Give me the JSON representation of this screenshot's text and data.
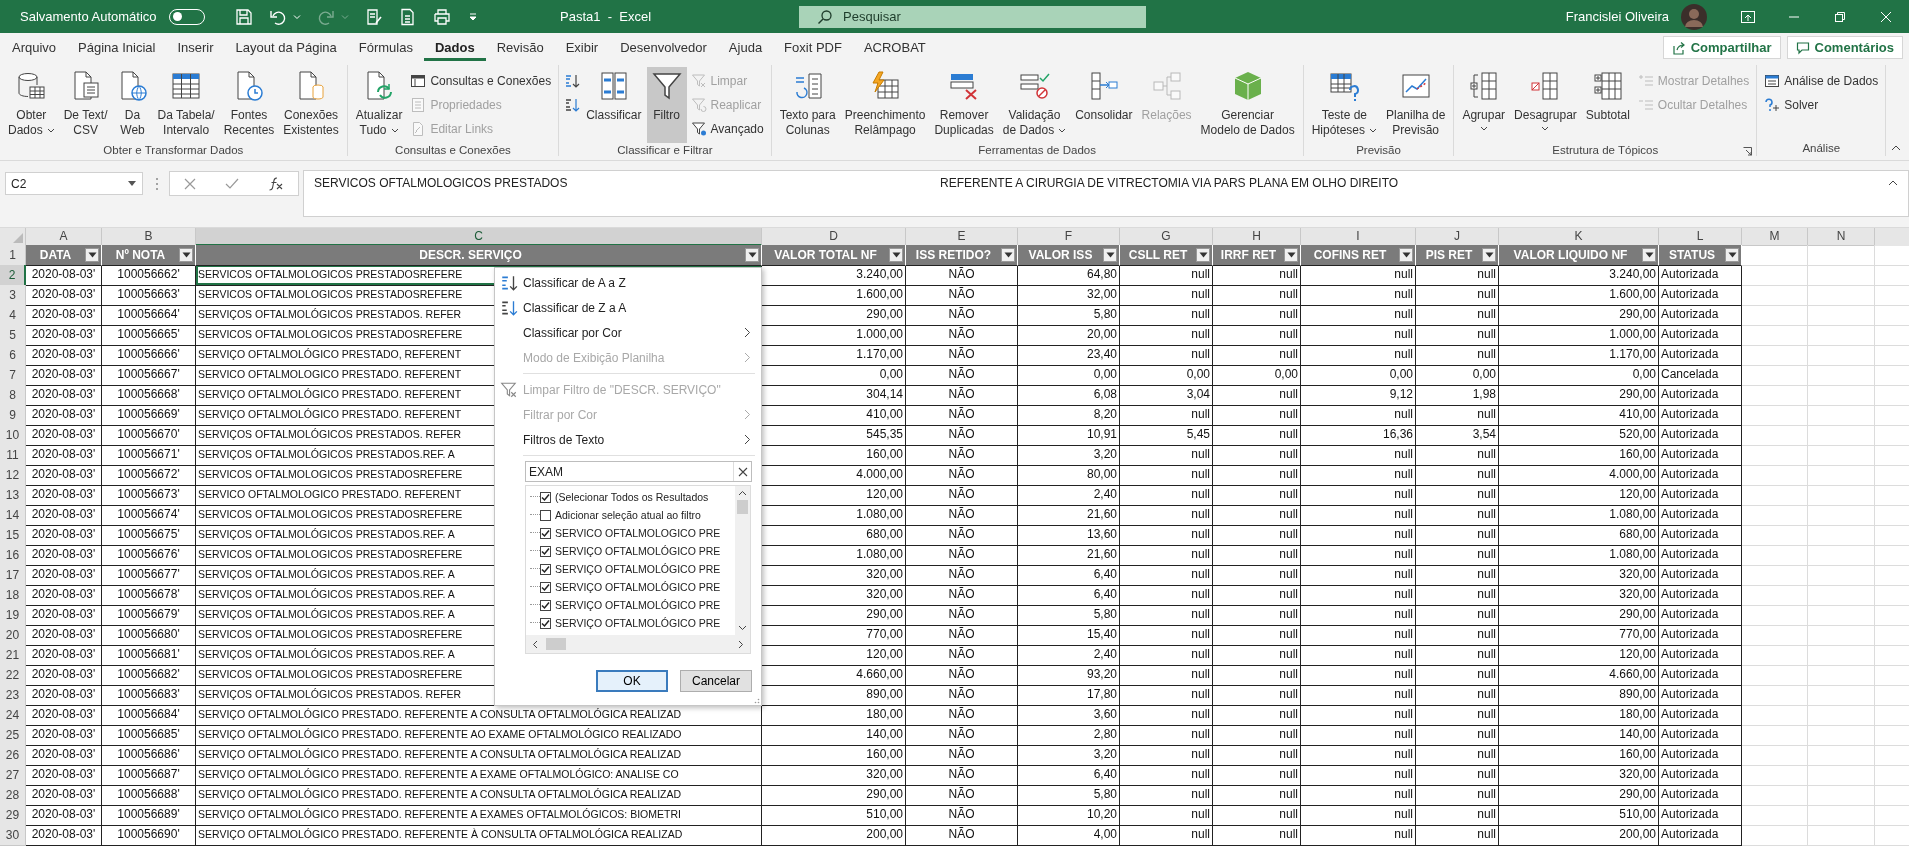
{
  "title_bar": {
    "autosave_label": "Salvamento Automático",
    "autosave_on": false,
    "title": "Pasta1  -  Excel",
    "search_placeholder": "Pesquisar",
    "user": "Francislei Oliveira"
  },
  "menu_tabs": [
    {
      "label": "Arquivo",
      "selected": false
    },
    {
      "label": "Página Inicial",
      "selected": false
    },
    {
      "label": "Inserir",
      "selected": false
    },
    {
      "label": "Layout da Página",
      "selected": false
    },
    {
      "label": "Fórmulas",
      "selected": false
    },
    {
      "label": "Dados",
      "selected": true
    },
    {
      "label": "Revisão",
      "selected": false
    },
    {
      "label": "Exibir",
      "selected": false
    },
    {
      "label": "Desenvolvedor",
      "selected": false
    },
    {
      "label": "Ajuda",
      "selected": false
    },
    {
      "label": "Foxit PDF",
      "selected": false
    },
    {
      "label": "ACROBAT",
      "selected": false
    }
  ],
  "share_button": "Compartilhar",
  "comments_button": "Comentários",
  "ribbon_groups": [
    {
      "title": "Obter e Transformar Dados",
      "launcher": false,
      "items": [
        {
          "kind": "large",
          "lines": [
            "Obter",
            "Dados"
          ],
          "dropdown": true,
          "disabled": false,
          "on": false
        },
        {
          "kind": "large",
          "lines": [
            "De Text/",
            "CSV"
          ],
          "dropdown": false,
          "disabled": false,
          "on": false
        },
        {
          "kind": "large",
          "lines": [
            "Da",
            "Web"
          ],
          "dropdown": false,
          "disabled": false,
          "on": false
        },
        {
          "kind": "large",
          "lines": [
            "Da Tabela/",
            "Intervalo"
          ],
          "dropdown": false,
          "disabled": false,
          "on": false
        },
        {
          "kind": "large",
          "lines": [
            "Fontes",
            "Recentes"
          ],
          "dropdown": false,
          "disabled": false,
          "on": false
        },
        {
          "kind": "large",
          "lines": [
            "Conexões",
            "Existentes"
          ],
          "dropdown": false,
          "disabled": false,
          "on": false
        }
      ]
    },
    {
      "title": "Consultas e Conexões",
      "launcher": false,
      "items": [
        {
          "kind": "large",
          "lines": [
            "Atualizar",
            "Tudo"
          ],
          "dropdown": true,
          "disabled": false,
          "on": false
        },
        {
          "kind": "stack",
          "items": [
            {
              "kind": "small",
              "label": "Consultas e Conexões",
              "dropdown": false,
              "disabled": false,
              "on": false
            },
            {
              "kind": "small",
              "label": "Propriedades",
              "dropdown": false,
              "disabled": true,
              "on": false
            },
            {
              "kind": "small",
              "label": "Editar Links",
              "dropdown": false,
              "disabled": true,
              "on": false
            }
          ]
        }
      ]
    },
    {
      "title": "Classificar e Filtrar",
      "launcher": false,
      "items": [
        {
          "kind": "stack",
          "items": [
            {
              "kind": "icon",
              "dropdown": false,
              "disabled": false,
              "on": false
            },
            {
              "kind": "icon",
              "dropdown": false,
              "disabled": false,
              "on": false
            }
          ]
        },
        {
          "kind": "large",
          "lines": [
            "Classificar"
          ],
          "dropdown": false,
          "disabled": false,
          "on": false
        },
        {
          "kind": "large",
          "lines": [
            "Filtro"
          ],
          "dropdown": false,
          "disabled": false,
          "on": true
        },
        {
          "kind": "stack",
          "items": [
            {
              "kind": "small",
              "label": "Limpar",
              "dropdown": false,
              "disabled": true,
              "on": false
            },
            {
              "kind": "small",
              "label": "Reaplicar",
              "dropdown": false,
              "disabled": true,
              "on": false
            },
            {
              "kind": "small",
              "label": "Avançado",
              "dropdown": false,
              "disabled": false,
              "on": false
            }
          ]
        }
      ]
    },
    {
      "title": "Ferramentas de Dados",
      "launcher": false,
      "items": [
        {
          "kind": "large",
          "lines": [
            "Texto para",
            "Colunas"
          ],
          "dropdown": false,
          "disabled": false,
          "on": false
        },
        {
          "kind": "large",
          "lines": [
            "Preenchimento",
            "Relâmpago"
          ],
          "dropdown": false,
          "disabled": false,
          "on": false
        },
        {
          "kind": "large",
          "lines": [
            "Remover",
            "Duplicadas"
          ],
          "dropdown": false,
          "disabled": false,
          "on": false
        },
        {
          "kind": "large",
          "lines": [
            "Validação",
            "de Dados"
          ],
          "dropdown": true,
          "disabled": false,
          "on": false
        },
        {
          "kind": "large",
          "lines": [
            "Consolidar"
          ],
          "dropdown": false,
          "disabled": false,
          "on": false
        },
        {
          "kind": "large",
          "lines": [
            "Relações"
          ],
          "dropdown": false,
          "disabled": true,
          "on": false
        },
        {
          "kind": "large",
          "lines": [
            "Gerenciar",
            "Modelo de Dados"
          ],
          "dropdown": false,
          "disabled": false,
          "on": false
        }
      ]
    },
    {
      "title": "Previsão",
      "launcher": false,
      "items": [
        {
          "kind": "large",
          "lines": [
            "Teste de",
            "Hipóteses"
          ],
          "dropdown": true,
          "disabled": false,
          "on": false
        },
        {
          "kind": "large",
          "lines": [
            "Planilha de",
            "Previsão"
          ],
          "dropdown": false,
          "disabled": false,
          "on": false
        }
      ]
    },
    {
      "title": "Estrutura de Tópicos",
      "launcher": true,
      "items": [
        {
          "kind": "large",
          "lines": [
            "Agrupar"
          ],
          "dropdown": true,
          "disabled": false,
          "on": false
        },
        {
          "kind": "large",
          "lines": [
            "Desagrupar"
          ],
          "dropdown": true,
          "disabled": false,
          "on": false
        },
        {
          "kind": "large",
          "lines": [
            "Subtotal"
          ],
          "dropdown": false,
          "disabled": false,
          "on": false
        },
        {
          "kind": "stack",
          "items": [
            {
              "kind": "small",
              "label": "Mostrar Detalhes",
              "dropdown": false,
              "disabled": true,
              "on": false
            },
            {
              "kind": "small",
              "label": "Ocultar Detalhes",
              "dropdown": false,
              "disabled": true,
              "on": false
            }
          ]
        }
      ]
    },
    {
      "title": "Análise",
      "launcher": false,
      "items": [
        {
          "kind": "stack",
          "items": [
            {
              "kind": "small",
              "label": "Análise de Dados",
              "dropdown": false,
              "disabled": false,
              "on": false
            },
            {
              "kind": "small",
              "label": "Solver",
              "dropdown": false,
              "disabled": false,
              "on": false
            }
          ]
        }
      ]
    }
  ],
  "formula_bar": {
    "name_box": "C2",
    "value_parts": [
      "SERVICOS OFTALMOLOGICOS PRESTADOS",
      "REFERENTE A CIRURGIA DE VITRECTOMIA VIA PARS PLANA EM OLHO DIREITO"
    ]
  },
  "sheet": {
    "columns": [
      {
        "letter": "A",
        "selected": false
      },
      {
        "letter": "B",
        "selected": false
      },
      {
        "letter": "C",
        "selected": true
      },
      {
        "letter": "D",
        "selected": false
      },
      {
        "letter": "E",
        "selected": false
      },
      {
        "letter": "F",
        "selected": false
      },
      {
        "letter": "G",
        "selected": false
      },
      {
        "letter": "H",
        "selected": false
      },
      {
        "letter": "I",
        "selected": false
      },
      {
        "letter": "J",
        "selected": false
      },
      {
        "letter": "K",
        "selected": false
      },
      {
        "letter": "L",
        "selected": false
      },
      {
        "letter": "M",
        "selected": false
      },
      {
        "letter": "N",
        "selected": false
      }
    ],
    "header_row": {
      "number": "1",
      "cells": [
        "DATA",
        "Nº NOTA",
        "DESCR. SERVIÇO",
        "VALOR TOTAL NF",
        "ISS RETIDO?",
        "VALOR ISS",
        "CSLL RET",
        "IRRF RET",
        "COFINS RET",
        "PIS RET",
        "VALOR LIQUIDO NF",
        "STATUS"
      ]
    },
    "rows": [
      {
        "number": "2",
        "selected": true,
        "cells": [
          "2020-08-03'",
          "100056662'",
          "SERVICOS OFTALMOLOGICOS PRESTADOSREFERE",
          "3.240,00",
          "NÃO",
          "64,80",
          "null",
          "null",
          "null",
          "null",
          "3.240,00",
          "Autorizada"
        ]
      },
      {
        "number": "3",
        "selected": false,
        "cells": [
          "2020-08-03'",
          "100056663'",
          "SERVICOS OFTALMOLOGICOS PRESTADOSREFERE",
          "1.600,00",
          "NÃO",
          "32,00",
          "null",
          "null",
          "null",
          "null",
          "1.600,00",
          "Autorizada"
        ]
      },
      {
        "number": "4",
        "selected": false,
        "cells": [
          "2020-08-03'",
          "100056664'",
          "SERVIÇOS OFTALMOLÓGICOS PRESTADOS. REFER",
          "290,00",
          "NÃO",
          "5,80",
          "null",
          "null",
          "null",
          "null",
          "290,00",
          "Autorizada"
        ]
      },
      {
        "number": "5",
        "selected": false,
        "cells": [
          "2020-08-03'",
          "100056665'",
          "SERVICOS OFTALMOLOGICOS PRESTADOSREFERE",
          "1.000,00",
          "NÃO",
          "20,00",
          "null",
          "null",
          "null",
          "null",
          "1.000,00",
          "Autorizada"
        ]
      },
      {
        "number": "6",
        "selected": false,
        "cells": [
          "2020-08-03'",
          "100056666'",
          "SERVIÇO OFTALMOLÓGICO PRESTADO, REFERENT",
          "1.170,00",
          "NÃO",
          "23,40",
          "null",
          "null",
          "null",
          "null",
          "1.170,00",
          "Autorizada"
        ]
      },
      {
        "number": "7",
        "selected": false,
        "cells": [
          "2020-08-03'",
          "100056667'",
          "SERVICO OFTALMOLOGICO PRESTADO. REFERENT",
          "0,00",
          "NÃO",
          "0,00",
          "0,00",
          "0,00",
          "0,00",
          "0,00",
          "0,00",
          "Cancelada"
        ]
      },
      {
        "number": "8",
        "selected": false,
        "cells": [
          "2020-08-03'",
          "100056668'",
          "SERVIÇO OFTALMOLÓGICO PRESTADO. REFERENT",
          "304,14",
          "NÃO",
          "6,08",
          "3,04",
          "null",
          "9,12",
          "1,98",
          "290,00",
          "Autorizada"
        ]
      },
      {
        "number": "9",
        "selected": false,
        "cells": [
          "2020-08-03'",
          "100056669'",
          "SERVIÇO OFTALMOLÓGICO PRESTADO. REFERENT",
          "410,00",
          "NÃO",
          "8,20",
          "null",
          "null",
          "null",
          "null",
          "410,00",
          "Autorizada"
        ]
      },
      {
        "number": "10",
        "selected": false,
        "cells": [
          "2020-08-03'",
          "100056670'",
          "SERVIÇOS OFTALMOLÓGICOS PRESTADOS. REFER",
          "545,35",
          "NÃO",
          "10,91",
          "5,45",
          "null",
          "16,36",
          "3,54",
          "520,00",
          "Autorizada"
        ]
      },
      {
        "number": "11",
        "selected": false,
        "cells": [
          "2020-08-03'",
          "100056671'",
          "SERVIÇOS OFTALMOLÓGICOS PRESTADOS.REF. A",
          "160,00",
          "NÃO",
          "3,20",
          "null",
          "null",
          "null",
          "null",
          "160,00",
          "Autorizada"
        ]
      },
      {
        "number": "12",
        "selected": false,
        "cells": [
          "2020-08-03'",
          "100056672'",
          "SERVICOS OFTALMOLOGICOS PRESTADOSREFERE",
          "4.000,00",
          "NÃO",
          "80,00",
          "null",
          "null",
          "null",
          "null",
          "4.000,00",
          "Autorizada"
        ]
      },
      {
        "number": "13",
        "selected": false,
        "cells": [
          "2020-08-03'",
          "100056673'",
          "SERVICO OFTALMOLOGICO PRESTADO. REFERENT",
          "120,00",
          "NÃO",
          "2,40",
          "null",
          "null",
          "null",
          "null",
          "120,00",
          "Autorizada"
        ]
      },
      {
        "number": "14",
        "selected": false,
        "cells": [
          "2020-08-03'",
          "100056674'",
          "SERVICOS OFTALMOLOGICOS PRESTADOSREFERE",
          "1.080,00",
          "NÃO",
          "21,60",
          "null",
          "null",
          "null",
          "null",
          "1.080,00",
          "Autorizada"
        ]
      },
      {
        "number": "15",
        "selected": false,
        "cells": [
          "2020-08-03'",
          "100056675'",
          "SERVIÇOS OFTALMOLÓGICOS PRESTADOS.REF. A",
          "680,00",
          "NÃO",
          "13,60",
          "null",
          "null",
          "null",
          "null",
          "680,00",
          "Autorizada"
        ]
      },
      {
        "number": "16",
        "selected": false,
        "cells": [
          "2020-08-03'",
          "100056676'",
          "SERVICOS OFTALMOLOGICOS PRESTADOSREFERE",
          "1.080,00",
          "NÃO",
          "21,60",
          "null",
          "null",
          "null",
          "null",
          "1.080,00",
          "Autorizada"
        ]
      },
      {
        "number": "17",
        "selected": false,
        "cells": [
          "2020-08-03'",
          "100056677'",
          "SERVIÇOS OFTALMOLÓGICOS PRESTADOS.REF. A",
          "320,00",
          "NÃO",
          "6,40",
          "null",
          "null",
          "null",
          "null",
          "320,00",
          "Autorizada"
        ]
      },
      {
        "number": "18",
        "selected": false,
        "cells": [
          "2020-08-03'",
          "100056678'",
          "SERVIÇOS OFTALMOLÓGICOS PRESTADOS.REF. A",
          "320,00",
          "NÃO",
          "6,40",
          "null",
          "null",
          "null",
          "null",
          "320,00",
          "Autorizada"
        ]
      },
      {
        "number": "19",
        "selected": false,
        "cells": [
          "2020-08-03'",
          "100056679'",
          "SERVIÇOS OFTALMOLÓGICOS PRESTADOS.REF. A",
          "290,00",
          "NÃO",
          "5,80",
          "null",
          "null",
          "null",
          "null",
          "290,00",
          "Autorizada"
        ]
      },
      {
        "number": "20",
        "selected": false,
        "cells": [
          "2020-08-03'",
          "100056680'",
          "SERVICOS OFTALMOLOGICOS PRESTADOSREFERE",
          "770,00",
          "NÃO",
          "15,40",
          "null",
          "null",
          "null",
          "null",
          "770,00",
          "Autorizada"
        ]
      },
      {
        "number": "21",
        "selected": false,
        "cells": [
          "2020-08-03'",
          "100056681'",
          "SERVIÇOS OFTALMOLÓGICOS PRESTADOS.REF. A",
          "120,00",
          "NÃO",
          "2,40",
          "null",
          "null",
          "null",
          "null",
          "120,00",
          "Autorizada"
        ]
      },
      {
        "number": "22",
        "selected": false,
        "cells": [
          "2020-08-03'",
          "100056682'",
          "SERVICOS OFTALMOLOGICOS PRESTADOSREFERE",
          "4.660,00",
          "NÃO",
          "93,20",
          "null",
          "null",
          "null",
          "null",
          "4.660,00",
          "Autorizada"
        ]
      },
      {
        "number": "23",
        "selected": false,
        "cells": [
          "2020-08-03'",
          "100056683'",
          "SERVIÇOS OFTALMOLÓGICOS PRESTADOS. REFER",
          "890,00",
          "NÃO",
          "17,80",
          "null",
          "null",
          "null",
          "null",
          "890,00",
          "Autorizada"
        ]
      },
      {
        "number": "24",
        "selected": false,
        "cells": [
          "2020-08-03'",
          "100056684'",
          "SERVIÇO OFTALMOLÓGICO PRESTADO. REFERENTE A CONSULTA OFTALMOLÓGICA REALIZAD",
          "180,00",
          "NÃO",
          "3,60",
          "null",
          "null",
          "null",
          "null",
          "180,00",
          "Autorizada"
        ]
      },
      {
        "number": "25",
        "selected": false,
        "cells": [
          "2020-08-03'",
          "100056685'",
          "SERVIÇO OFTALMOLÓGICO PRESTADO. REFERENTE AO EXAME OFTALMOLÓGICO REALIZADO",
          "140,00",
          "NÃO",
          "2,80",
          "null",
          "null",
          "null",
          "null",
          "140,00",
          "Autorizada"
        ]
      },
      {
        "number": "26",
        "selected": false,
        "cells": [
          "2020-08-03'",
          "100056686'",
          "SERVIÇO OFTALMOLÓGICO PRESTADO. REFERENTE A CONSULTA OFTALMOLÓGICA REALIZAD",
          "160,00",
          "NÃO",
          "3,20",
          "null",
          "null",
          "null",
          "null",
          "160,00",
          "Autorizada"
        ]
      },
      {
        "number": "27",
        "selected": false,
        "cells": [
          "2020-08-03'",
          "100056687'",
          "SERVIÇO OFTALMOLÓGICO PRESTADO. REFERENTE A EXAME OFTALMOLÓGICO: ANALISE CO",
          "320,00",
          "NÃO",
          "6,40",
          "null",
          "null",
          "null",
          "null",
          "320,00",
          "Autorizada"
        ]
      },
      {
        "number": "28",
        "selected": false,
        "cells": [
          "2020-08-03'",
          "100056688'",
          "SERVIÇO OFTALMOLÓGICO PRESTADO. REFERENTE A CONSULTA OFTALMOLÓGICA REALIZAD",
          "290,00",
          "NÃO",
          "5,80",
          "null",
          "null",
          "null",
          "null",
          "290,00",
          "Autorizada"
        ]
      },
      {
        "number": "29",
        "selected": false,
        "cells": [
          "2020-08-03'",
          "100056689'",
          "SERVIÇO OFTALMOLÓGICO PRESTADO. REFERENTE A EXAMES OFTALMOLÓGICOS: BIOMETRI",
          "510,00",
          "NÃO",
          "10,20",
          "null",
          "null",
          "null",
          "null",
          "510,00",
          "Autorizada"
        ]
      },
      {
        "number": "30",
        "selected": false,
        "cells": [
          "2020-08-03'",
          "100056690'",
          "SERVIÇO OFTALMOLÓGICO PRESTADO. REFERENTE À CONSULTA OFTALMOLÓGICA REALIZAD",
          "200,00",
          "NÃO",
          "4,00",
          "null",
          "null",
          "null",
          "null",
          "200,00",
          "Autorizada"
        ]
      }
    ]
  },
  "filter_menu": {
    "items": [
      {
        "kind": "sort",
        "label": "Classificar de A a Z",
        "disabled": false,
        "submenu": false
      },
      {
        "kind": "sort",
        "label": "Classificar de Z a A",
        "disabled": false,
        "submenu": false
      },
      {
        "kind": "plain",
        "label": "Classificar por Cor",
        "disabled": false,
        "submenu": true
      },
      {
        "kind": "plain",
        "label": "Modo de Exibição Planilha",
        "disabled": true,
        "submenu": true
      },
      {
        "kind": "clear",
        "label": "Limpar Filtro de \"DESCR. SERVIÇO\"",
        "disabled": true,
        "submenu": false
      },
      {
        "kind": "plain",
        "label": "Filtrar por Cor",
        "disabled": true,
        "submenu": true
      },
      {
        "kind": "plain",
        "label": "Filtros de Texto",
        "disabled": false,
        "submenu": true
      }
    ],
    "search_value": "EXAM",
    "values": [
      {
        "label": "(Selecionar Todos os Resultados",
        "checked": true
      },
      {
        "label": "Adicionar seleção atual ao filtro",
        "checked": false
      },
      {
        "label": "SERVICO OFTALMOLOGICO PRE",
        "checked": true
      },
      {
        "label": "SERVIÇO OFTALMOLÓGICO PRE",
        "checked": true
      },
      {
        "label": "SERVIÇO OFTALMOLÓGICO PRE",
        "checked": true
      },
      {
        "label": "SERVIÇO OFTALMOLÓGICO PRE",
        "checked": true
      },
      {
        "label": "SERVIÇO OFTALMOLÓGICO PRE",
        "checked": true
      },
      {
        "label": "SERVIÇO OFTALMOLÓGICO PRE",
        "checked": true
      }
    ],
    "ok": "OK",
    "cancel": "Cancelar"
  }
}
